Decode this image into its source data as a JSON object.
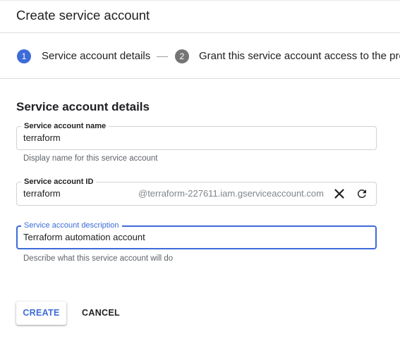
{
  "header": {
    "title": "Create service account"
  },
  "stepper": {
    "steps": [
      {
        "number": "1",
        "label": "Service account details",
        "state": "active"
      },
      {
        "number": "2",
        "label": "Grant this service account access to the project",
        "state": "inactive"
      }
    ]
  },
  "form": {
    "section_title": "Service account details",
    "name_field": {
      "label": "Service account name",
      "value": "terraform",
      "hint": "Display name for this service account"
    },
    "id_field": {
      "label": "Service account ID",
      "value": "terraform",
      "suffix": "@terraform-227611.iam.gserviceaccount.com",
      "clear_icon": "close-icon",
      "refresh_icon": "refresh-icon"
    },
    "description_field": {
      "label": "Service account description",
      "value": "Terraform automation account",
      "hint": "Describe what this service account will do"
    }
  },
  "actions": {
    "create_label": "CREATE",
    "cancel_label": "CANCEL"
  },
  "colors": {
    "accent": "#3d6bd8",
    "step_inactive": "#757575",
    "border": "#cfd2d6",
    "hint_text": "#5f6368",
    "suffix_text": "#80868b"
  }
}
